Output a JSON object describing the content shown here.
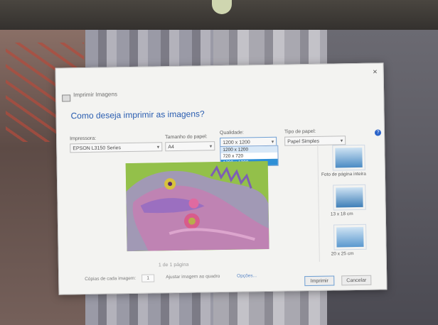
{
  "window": {
    "title": "Imprimir Imagens",
    "close_glyph": "×"
  },
  "dialog": {
    "heading": "Como deseja imprimir as imagens?"
  },
  "printer": {
    "label": "Impressora:",
    "value": "EPSON L3150 Series"
  },
  "paper_size": {
    "label": "Tamanho do papel:",
    "value": "A4"
  },
  "quality": {
    "label": "Qualidade:",
    "value": "1200 x 1200",
    "options": [
      "1200 x 1200",
      "720 x 720",
      "1200 x 1200"
    ],
    "selected_index": 2
  },
  "paper_type": {
    "label": "Tipo de papel:",
    "value": "Papel Simples"
  },
  "help_icon": "question-icon",
  "layouts": [
    {
      "caption": "Foto de página inteira",
      "color": "#4b8bc4"
    },
    {
      "caption": "13 x 18 cm",
      "color": "#3f7fb8"
    },
    {
      "caption": "20 x 25 cm",
      "color": "#5a98cf"
    }
  ],
  "preview_nav": {
    "text": "1 de 1 página"
  },
  "footer": {
    "copies_label": "Cópias de cada imagem:",
    "copies_value": "1",
    "fit_label": "Ajustar imagem ao quadro",
    "options_link": "Opções...",
    "print_button": "Imprimir",
    "cancel_button": "Cancelar"
  },
  "colors": {
    "heading": "#2a5db0",
    "selection": "#2e8fd6",
    "preview_bg": "#8fbf43"
  }
}
